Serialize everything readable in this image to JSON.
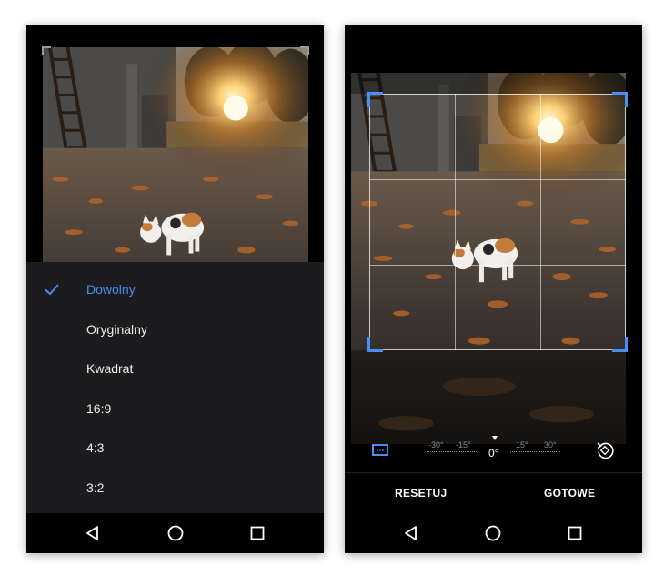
{
  "left_screen": {
    "aspect_menu": {
      "items": [
        {
          "label": "Dowolny",
          "selected": true
        },
        {
          "label": "Oryginalny",
          "selected": false
        },
        {
          "label": "Kwadrat",
          "selected": false
        },
        {
          "label": "16:9",
          "selected": false
        },
        {
          "label": "4:3",
          "selected": false
        },
        {
          "label": "3:2",
          "selected": false
        }
      ]
    }
  },
  "right_screen": {
    "straighten": {
      "ticks": [
        "-30°",
        "-15°",
        "15°",
        "30°"
      ],
      "current_angle": "0°"
    },
    "actions": {
      "reset_label": "RESETUJ",
      "done_label": "GOTOWE"
    }
  },
  "nav_bar": {
    "back_icon": "back-triangle-icon",
    "home_icon": "home-circle-icon",
    "recents_icon": "recents-square-icon"
  },
  "colors": {
    "accent": "#4a8ef5",
    "menu_background": "#1c1c1e",
    "screen_background": "#000000"
  }
}
